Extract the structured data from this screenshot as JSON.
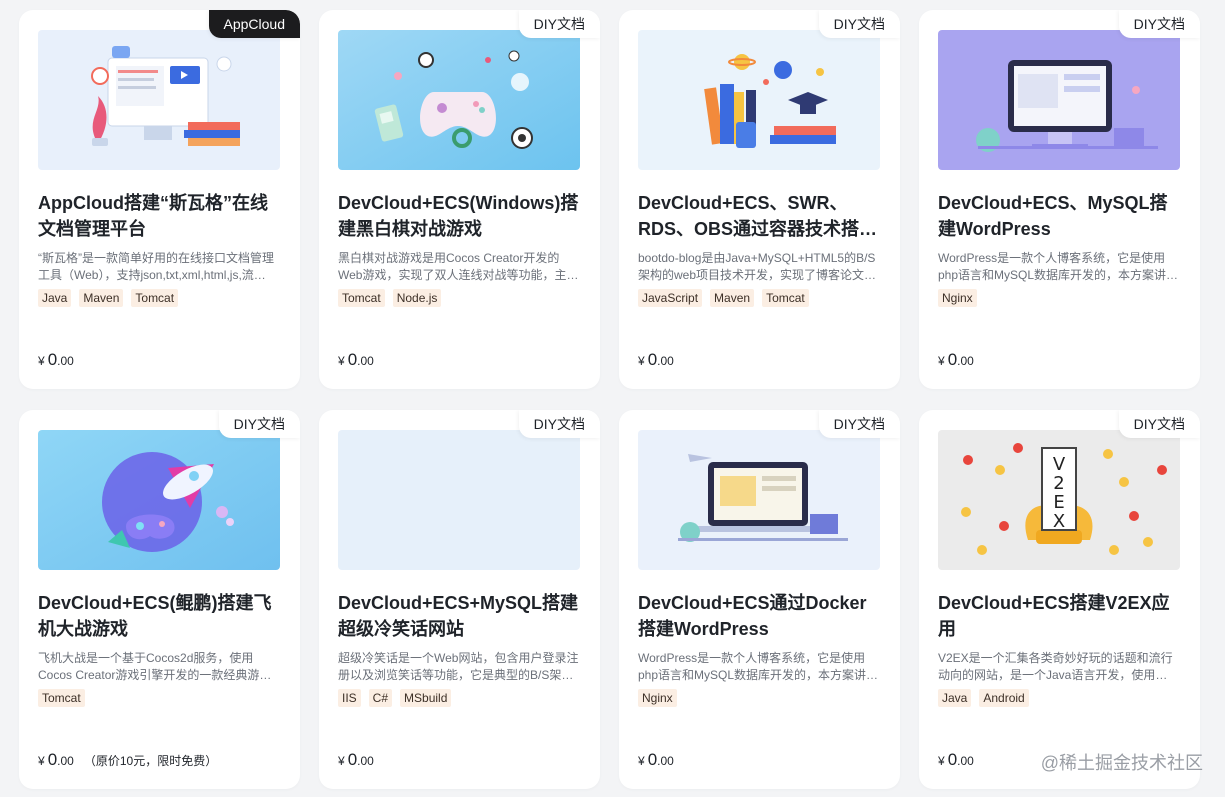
{
  "cards": [
    {
      "badge": "AppCloud",
      "title": "AppCloud搭建“斯瓦格”在线文档管理平台",
      "desc": "“斯瓦格”是一款简单好用的在线接口文档管理工具（Web），支持json,txt,xml,html,js,流…",
      "tags": [
        "Java",
        "Maven",
        "Tomcat"
      ],
      "price_symbol": "¥",
      "price_int": "0",
      "price_dec": ".00",
      "price_note": ""
    },
    {
      "badge": "DIY文档",
      "title": "DevCloud+ECS(Windows)搭建黑白棋对战游戏",
      "desc": "黑白棋对战游戏是用Cocos Creator开发的Web游戏，实现了双人连线对战等功能，主…",
      "tags": [
        "Tomcat",
        "Node.js"
      ],
      "price_symbol": "¥",
      "price_int": "0",
      "price_dec": ".00",
      "price_note": ""
    },
    {
      "badge": "DIY文档",
      "title": "DevCloud+ECS、SWR、RDS、OBS通过容器技术搭…",
      "desc": "bootdo-blog是由Java+MySQL+HTML5的B/S架构的web项目技术开发，实现了博客论文…",
      "tags": [
        "JavaScript",
        "Maven",
        "Tomcat"
      ],
      "price_symbol": "¥",
      "price_int": "0",
      "price_dec": ".00",
      "price_note": ""
    },
    {
      "badge": "DIY文档",
      "title": "DevCloud+ECS、MySQL搭建WordPress",
      "desc": "WordPress是一款个人博客系统，它是使用php语言和MySQL数据库开发的，本方案讲…",
      "tags": [
        "Nginx"
      ],
      "price_symbol": "¥",
      "price_int": "0",
      "price_dec": ".00",
      "price_note": ""
    },
    {
      "badge": "DIY文档",
      "title": "DevCloud+ECS(鲲鹏)搭建飞机大战游戏",
      "desc": "飞机大战是一个基于Cocos2d服务，使用Cocos Creator游戏引擎开发的一款经典游…",
      "tags": [
        "Tomcat"
      ],
      "price_symbol": "¥",
      "price_int": "0",
      "price_dec": ".00",
      "price_note": "（原价10元，限时免费）"
    },
    {
      "badge": "DIY文档",
      "title": "DevCloud+ECS+MySQL搭建超级冷笑话网站",
      "desc": "超级冷笑话是一个Web网站，包含用户登录注册以及浏览笑话等功能，它是典型的B/S架…",
      "tags": [
        "IIS",
        "C#",
        "MSbuild"
      ],
      "price_symbol": "¥",
      "price_int": "0",
      "price_dec": ".00",
      "price_note": ""
    },
    {
      "badge": "DIY文档",
      "title": "DevCloud+ECS通过Docker搭建WordPress",
      "desc": "WordPress是一款个人博客系统，它是使用php语言和MySQL数据库开发的，本方案讲…",
      "tags": [
        "Nginx"
      ],
      "price_symbol": "¥",
      "price_int": "0",
      "price_dec": ".00",
      "price_note": ""
    },
    {
      "badge": "DIY文档",
      "title": "DevCloud+ECS搭建V2EX应用",
      "desc": "V2EX是一个汇集各类奇妙好玩的话题和流行动向的网站，是一个Java语言开发，使用…",
      "tags": [
        "Java",
        "Android"
      ],
      "price_symbol": "¥",
      "price_int": "0",
      "price_dec": ".00",
      "price_note": ""
    }
  ],
  "thumb_text": {
    "v2ex": [
      "V",
      "2",
      "E",
      "X"
    ]
  },
  "watermark": "@稀土掘金技术社区"
}
